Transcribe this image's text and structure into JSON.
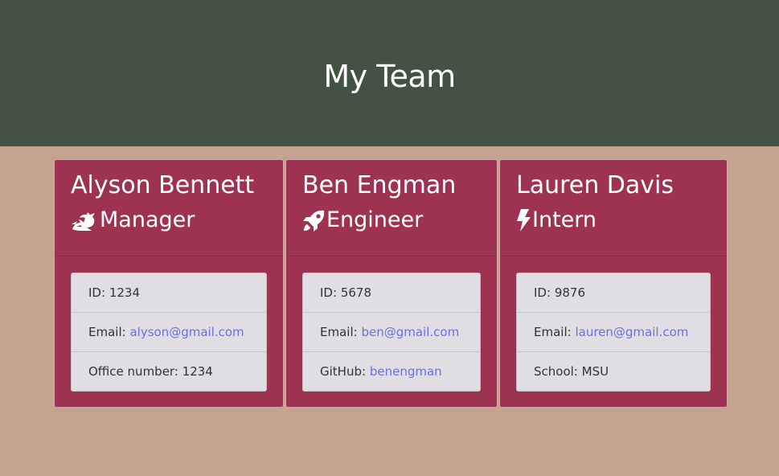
{
  "header": {
    "title": "My Team"
  },
  "colors": {
    "header_bg": "#435244",
    "page_bg": "#c5a38f",
    "card_bg": "#9d3350",
    "list_bg": "#e0dee3",
    "link": "#6a6fe0"
  },
  "team": [
    {
      "name": "Alyson Bennett",
      "role": "Manager",
      "icon": "dragon-icon",
      "id_label": "ID:",
      "id": "1234",
      "email_label": "Email:",
      "email": "alyson@gmail.com",
      "extra_label": "Office number:",
      "extra_value": "1234"
    },
    {
      "name": "Ben Engman",
      "role": "Engineer",
      "icon": "rocket-icon",
      "id_label": "ID:",
      "id": "5678",
      "email_label": "Email:",
      "email": "ben@gmail.com",
      "extra_label": "GitHub:",
      "extra_value": "benengman"
    },
    {
      "name": "Lauren Davis",
      "role": "Intern",
      "icon": "bolt-icon",
      "id_label": "ID:",
      "id": "9876",
      "email_label": "Email:",
      "email": "lauren@gmail.com",
      "extra_label": "School:",
      "extra_value": "MSU"
    }
  ]
}
